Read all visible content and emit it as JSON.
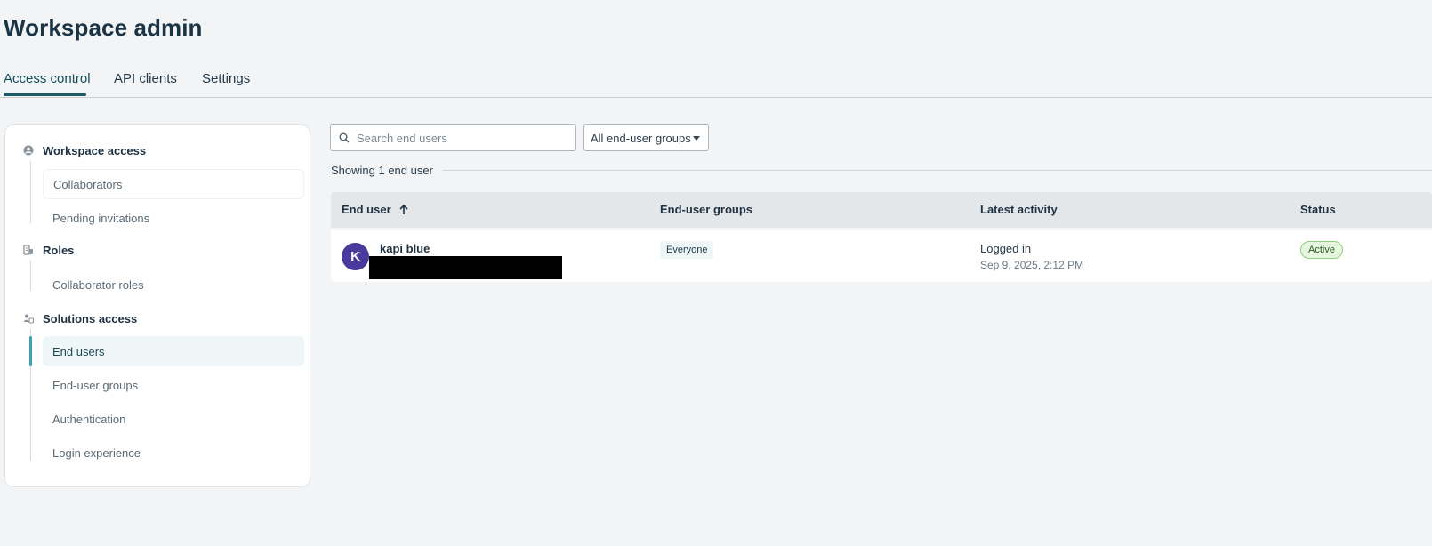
{
  "page": {
    "title": "Workspace admin"
  },
  "tabs": [
    {
      "label": "Access control",
      "active": true
    },
    {
      "label": "API clients",
      "active": false
    },
    {
      "label": "Settings",
      "active": false
    }
  ],
  "sidebar": {
    "sections": [
      {
        "label": "Workspace access",
        "icon": "user-circle-icon",
        "items": [
          {
            "label": "Collaborators"
          },
          {
            "label": "Pending invitations"
          }
        ]
      },
      {
        "label": "Roles",
        "icon": "roles-icon",
        "items": [
          {
            "label": "Collaborator roles"
          }
        ]
      },
      {
        "label": "Solutions access",
        "icon": "people-icon",
        "items": [
          {
            "label": "End users",
            "active": true
          },
          {
            "label": "End-user groups"
          },
          {
            "label": "Authentication"
          },
          {
            "label": "Login experience"
          }
        ]
      }
    ]
  },
  "search": {
    "placeholder": "Search end users",
    "value": ""
  },
  "filter": {
    "selected": "All end-user groups"
  },
  "summary": {
    "text": "Showing 1 end user"
  },
  "table": {
    "columns": [
      {
        "label": "End user",
        "sort": "ascending"
      },
      {
        "label": "End-user groups"
      },
      {
        "label": "Latest activity"
      },
      {
        "label": "Status"
      }
    ],
    "rows": [
      {
        "avatar_initial": "K",
        "avatar_color": "#4a3a9c",
        "name": "kapi blue",
        "groups": [
          "Everyone"
        ],
        "activity": "Logged in",
        "activity_time": "Sep 9, 2025, 2:12 PM",
        "status": "Active"
      }
    ]
  },
  "colors": {
    "accent": "#1a5a64",
    "active_status_bg": "#e6f6df",
    "active_status_border": "#8fcf7b"
  }
}
